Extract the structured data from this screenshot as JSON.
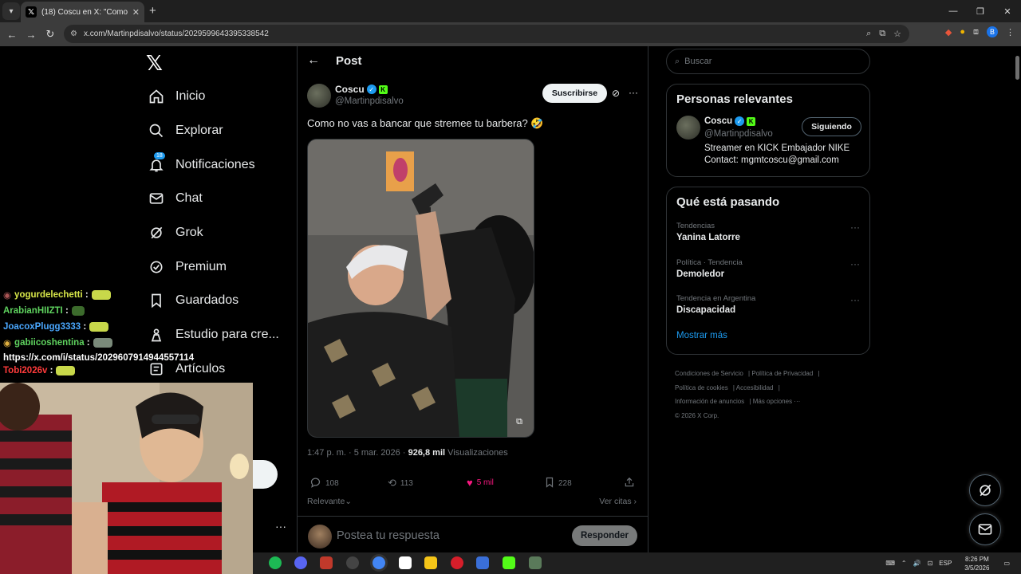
{
  "browser": {
    "tab_title": "(18) Coscu en X: \"Como no vas",
    "url": "x.com/Martinpdisalvo/status/2029599643395338542"
  },
  "nav": {
    "items": [
      {
        "label": "Inicio",
        "icon": "home-icon"
      },
      {
        "label": "Explorar",
        "icon": "search-icon"
      },
      {
        "label": "Notificaciones",
        "icon": "bell-icon",
        "badge": "18"
      },
      {
        "label": "Chat",
        "icon": "mail-icon"
      },
      {
        "label": "Grok",
        "icon": "grok-icon"
      },
      {
        "label": "Premium",
        "icon": "premium-icon"
      },
      {
        "label": "Guardados",
        "icon": "bookmark-icon"
      },
      {
        "label": "Estudio para cre...",
        "icon": "studio-icon"
      },
      {
        "label": "Artículos",
        "icon": "article-icon"
      }
    ]
  },
  "chat_overlay": {
    "lines": [
      {
        "user": "yogurdelechetti",
        "color": "#d9e84a"
      },
      {
        "user": "ArabianHIIZTI",
        "color": "#5fd35f"
      },
      {
        "user": "JoacoxPlugg3333",
        "color": "#4aa8ff"
      },
      {
        "user": "gabiicoshentina",
        "color": "#5fd35f"
      },
      {
        "user": "Tobi2026v",
        "color": "#ff3b3b"
      }
    ],
    "url_line": "https://x.com/i/status/2029607914944557114"
  },
  "post": {
    "header_title": "Post",
    "author_name": "Coscu",
    "author_handle": "@Martinpdisalvo",
    "subscribe_label": "Suscribirse",
    "text": "Como no vas a bancar que stremee tu barbera? 🤣",
    "time": "1:47 p. m. · 5 mar. 2026 ·",
    "views_count": "926,8 mil",
    "views_label": "Visualizaciones",
    "replies": "108",
    "reposts": "113",
    "likes": "5 mil",
    "bookmarks": "228",
    "filter_label": "Relevante",
    "quotes_label": "Ver citas",
    "reply_placeholder": "Postea tu respuesta",
    "reply_button": "Responder"
  },
  "sidebar": {
    "search_placeholder": "Buscar",
    "relevant_title": "Personas relevantes",
    "relevant_person": {
      "name": "Coscu",
      "handle": "@Martinpdisalvo",
      "bio_1": "Streamer en KICK Embajador NIKE",
      "bio_2": "Contact: mgmtcoscu@gmail.com",
      "follow_label": "Siguiendo"
    },
    "trends_title": "Qué está pasando",
    "trends": [
      {
        "context": "Tendencias",
        "name": "Yanina Latorre"
      },
      {
        "context": "Política · Tendencia",
        "name": "Demoledor"
      },
      {
        "context": "Tendencia en Argentina",
        "name": "Discapacidad"
      }
    ],
    "show_more": "Mostrar más",
    "footer": {
      "terms": "Condiciones de Servicio",
      "privacy": "Política de Privacidad",
      "cookies": "Política de cookies",
      "accessibility": "Accesibilidad",
      "ads": "Información de anuncios",
      "more": "Más opciones ···",
      "copyright": "© 2026 X Corp."
    }
  },
  "taskbar": {
    "lang": "ESP",
    "time": "8:26 PM",
    "date": "3/5/2026"
  },
  "colors": {
    "accent": "#1d9bf0",
    "like": "#f91880",
    "kick": "#53fc18"
  }
}
